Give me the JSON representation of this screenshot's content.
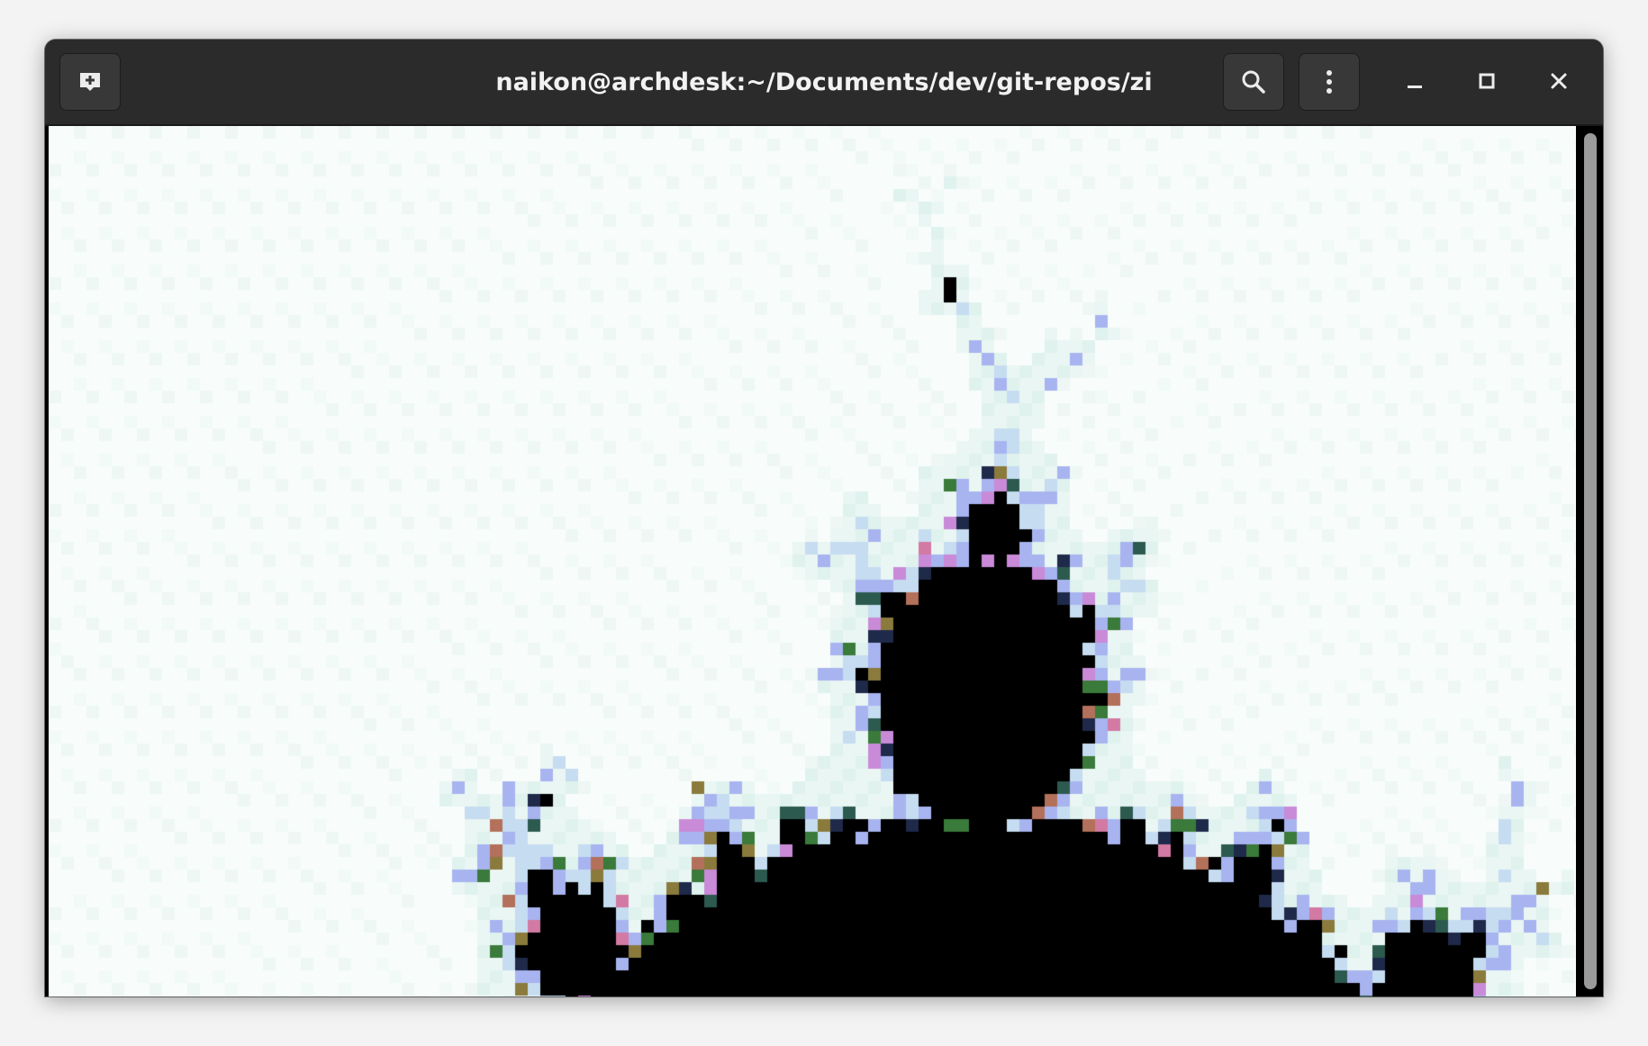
{
  "window": {
    "title": "naikon@archdesk:~/Documents/dev/git-repos/zi"
  },
  "titlebar": {
    "new_tab_icon": "new-tab-icon",
    "search_icon": "search-icon",
    "menu_icon": "kebab-menu-icon",
    "minimize_icon": "minimize-icon",
    "maximize_icon": "maximize-icon",
    "close_icon": "close-icon"
  },
  "terminal": {
    "content": "Mandelbrot fractal pixel render",
    "background_color": "#000000",
    "foreground_color": "#f7fcfa"
  },
  "colors": {
    "titlebar": "#2b2b2b",
    "button": "#383838",
    "title_text": "#f2f2f2",
    "scroll_thumb": "#9a9a9a"
  }
}
